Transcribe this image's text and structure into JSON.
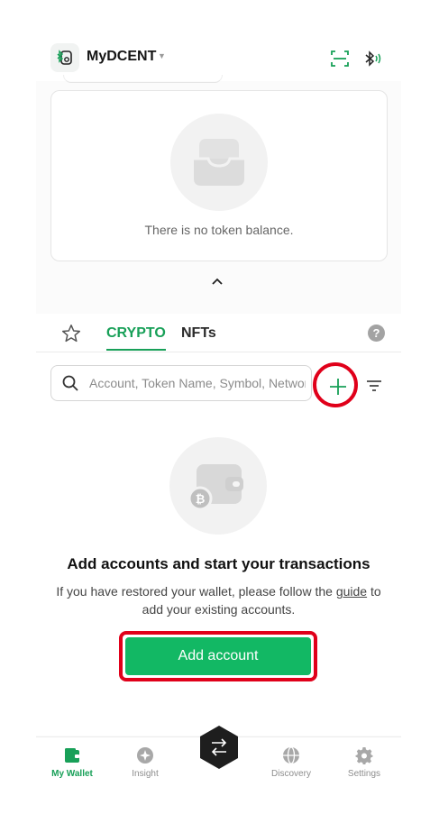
{
  "header": {
    "device_name": "MyDCENT"
  },
  "token_card": {
    "empty_text": "There is no token balance."
  },
  "tabs": {
    "crypto": "CRYPTO",
    "nfts": "NFTs",
    "help": "?"
  },
  "search": {
    "placeholder": "Account, Token Name, Symbol, Network"
  },
  "empty_accounts": {
    "title": "Add accounts and start your transactions",
    "desc_before": "If you have restored your wallet, please follow the ",
    "guide_link": "guide",
    "desc_after": " to add your existing accounts.",
    "button": "Add account"
  },
  "bottom_nav": {
    "my_wallet": "My Wallet",
    "insight": "Insight",
    "discovery": "Discovery",
    "settings": "Settings"
  },
  "colors": {
    "accent": "#18a058",
    "button": "#12b864",
    "highlight": "#e0001a"
  }
}
